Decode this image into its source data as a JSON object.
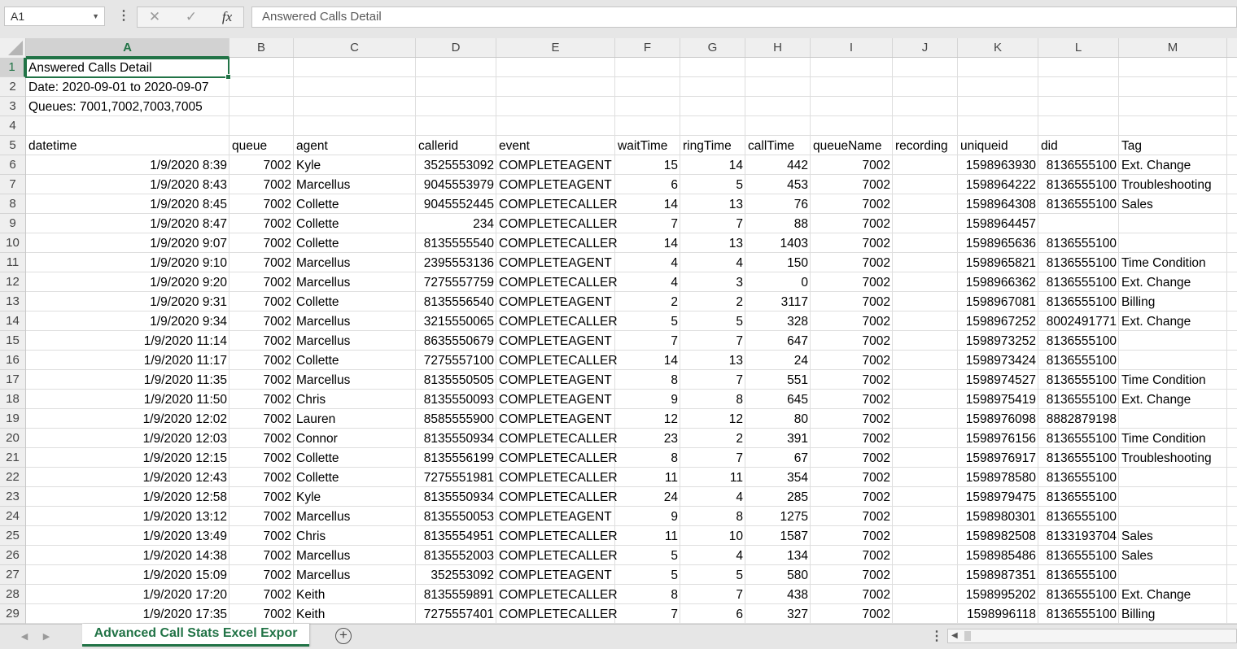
{
  "formula_bar": {
    "name_box": "A1",
    "cancel_icon": "✕",
    "enter_icon": "✓",
    "function_icon": "fx",
    "content": "Answered Calls Detail"
  },
  "columns": [
    "A",
    "B",
    "C",
    "D",
    "E",
    "F",
    "G",
    "H",
    "I",
    "J",
    "K",
    "L",
    "M"
  ],
  "rows": [
    "1",
    "2",
    "3",
    "4",
    "5",
    "6",
    "7",
    "8",
    "9",
    "10",
    "11",
    "12",
    "13",
    "14",
    "15",
    "16",
    "17",
    "18",
    "19",
    "20",
    "21",
    "22",
    "23",
    "24",
    "25",
    "26",
    "27",
    "28",
    "29"
  ],
  "meta_rows": [
    "Answered Calls Detail",
    "Date: 2020-09-01 to 2020-09-07",
    "Queues: 7001,7002,7003,7005"
  ],
  "headers": [
    "datetime",
    "queue",
    "agent",
    "callerid",
    "event",
    "waitTime",
    "ringTime",
    "callTime",
    "queueName",
    "recording",
    "uniqueid",
    "did",
    "Tag"
  ],
  "data": [
    [
      "1/9/2020 8:39",
      "7002",
      "Kyle",
      "3525553092",
      "COMPLETEAGENT",
      "15",
      "14",
      "442",
      "7002",
      "",
      "1598963930",
      "8136555100",
      "Ext. Change"
    ],
    [
      "1/9/2020 8:43",
      "7002",
      "Marcellus",
      "9045553979",
      "COMPLETEAGENT",
      "6",
      "5",
      "453",
      "7002",
      "",
      "1598964222",
      "8136555100",
      "Troubleshooting"
    ],
    [
      "1/9/2020 8:45",
      "7002",
      "Collette",
      "9045552445",
      "COMPLETECALLER",
      "14",
      "13",
      "76",
      "7002",
      "",
      "1598964308",
      "8136555100",
      "Sales"
    ],
    [
      "1/9/2020 8:47",
      "7002",
      "Collette",
      "234",
      "COMPLETECALLER",
      "7",
      "7",
      "88",
      "7002",
      "",
      "1598964457",
      "",
      ""
    ],
    [
      "1/9/2020 9:07",
      "7002",
      "Collette",
      "8135555540",
      "COMPLETECALLER",
      "14",
      "13",
      "1403",
      "7002",
      "",
      "1598965636",
      "8136555100",
      ""
    ],
    [
      "1/9/2020 9:10",
      "7002",
      "Marcellus",
      "2395553136",
      "COMPLETEAGENT",
      "4",
      "4",
      "150",
      "7002",
      "",
      "1598965821",
      "8136555100",
      "Time Condition"
    ],
    [
      "1/9/2020 9:20",
      "7002",
      "Marcellus",
      "7275557759",
      "COMPLETECALLER",
      "4",
      "3",
      "0",
      "7002",
      "",
      "1598966362",
      "8136555100",
      "Ext. Change"
    ],
    [
      "1/9/2020 9:31",
      "7002",
      "Collette",
      "8135556540",
      "COMPLETEAGENT",
      "2",
      "2",
      "3117",
      "7002",
      "",
      "1598967081",
      "8136555100",
      "Billing"
    ],
    [
      "1/9/2020 9:34",
      "7002",
      "Marcellus",
      "3215550065",
      "COMPLETECALLER",
      "5",
      "5",
      "328",
      "7002",
      "",
      "1598967252",
      "8002491771",
      "Ext. Change"
    ],
    [
      "1/9/2020 11:14",
      "7002",
      "Marcellus",
      "8635550679",
      "COMPLETEAGENT",
      "7",
      "7",
      "647",
      "7002",
      "",
      "1598973252",
      "8136555100",
      ""
    ],
    [
      "1/9/2020 11:17",
      "7002",
      "Collette",
      "7275557100",
      "COMPLETECALLER",
      "14",
      "13",
      "24",
      "7002",
      "",
      "1598973424",
      "8136555100",
      ""
    ],
    [
      "1/9/2020 11:35",
      "7002",
      "Marcellus",
      "8135550505",
      "COMPLETEAGENT",
      "8",
      "7",
      "551",
      "7002",
      "",
      "1598974527",
      "8136555100",
      "Time Condition"
    ],
    [
      "1/9/2020 11:50",
      "7002",
      "Chris",
      "8135550093",
      "COMPLETEAGENT",
      "9",
      "8",
      "645",
      "7002",
      "",
      "1598975419",
      "8136555100",
      "Ext. Change"
    ],
    [
      "1/9/2020 12:02",
      "7002",
      "Lauren",
      "8585555900",
      "COMPLETEAGENT",
      "12",
      "12",
      "80",
      "7002",
      "",
      "1598976098",
      "8882879198",
      ""
    ],
    [
      "1/9/2020 12:03",
      "7002",
      "Connor",
      "8135550934",
      "COMPLETECALLER",
      "23",
      "2",
      "391",
      "7002",
      "",
      "1598976156",
      "8136555100",
      "Time Condition"
    ],
    [
      "1/9/2020 12:15",
      "7002",
      "Collette",
      "8135556199",
      "COMPLETECALLER",
      "8",
      "7",
      "67",
      "7002",
      "",
      "1598976917",
      "8136555100",
      "Troubleshooting"
    ],
    [
      "1/9/2020 12:43",
      "7002",
      "Collette",
      "7275551981",
      "COMPLETECALLER",
      "11",
      "11",
      "354",
      "7002",
      "",
      "1598978580",
      "8136555100",
      ""
    ],
    [
      "1/9/2020 12:58",
      "7002",
      "Kyle",
      "8135550934",
      "COMPLETECALLER",
      "24",
      "4",
      "285",
      "7002",
      "",
      "1598979475",
      "8136555100",
      ""
    ],
    [
      "1/9/2020 13:12",
      "7002",
      "Marcellus",
      "8135550053",
      "COMPLETEAGENT",
      "9",
      "8",
      "1275",
      "7002",
      "",
      "1598980301",
      "8136555100",
      ""
    ],
    [
      "1/9/2020 13:49",
      "7002",
      "Chris",
      "8135554951",
      "COMPLETECALLER",
      "11",
      "10",
      "1587",
      "7002",
      "",
      "1598982508",
      "8133193704",
      "Sales"
    ],
    [
      "1/9/2020 14:38",
      "7002",
      "Marcellus",
      "8135552003",
      "COMPLETECALLER",
      "5",
      "4",
      "134",
      "7002",
      "",
      "1598985486",
      "8136555100",
      "Sales"
    ],
    [
      "1/9/2020 15:09",
      "7002",
      "Marcellus",
      "352553092",
      "COMPLETEAGENT",
      "5",
      "5",
      "580",
      "7002",
      "",
      "1598987351",
      "8136555100",
      ""
    ],
    [
      "1/9/2020 17:20",
      "7002",
      "Keith",
      "8135559891",
      "COMPLETECALLER",
      "8",
      "7",
      "438",
      "7002",
      "",
      "1598995202",
      "8136555100",
      "Ext. Change"
    ],
    [
      "1/9/2020 17:35",
      "7002",
      "Keith",
      "7275557401",
      "COMPLETECALLER",
      "7",
      "6",
      "327",
      "7002",
      "",
      "1598996118",
      "8136555100",
      "Billing"
    ]
  ],
  "sheet_tab": "Advanced Call Stats Excel Expor",
  "add_sheet_icon": "+",
  "colors": {
    "accent": "#217346"
  }
}
